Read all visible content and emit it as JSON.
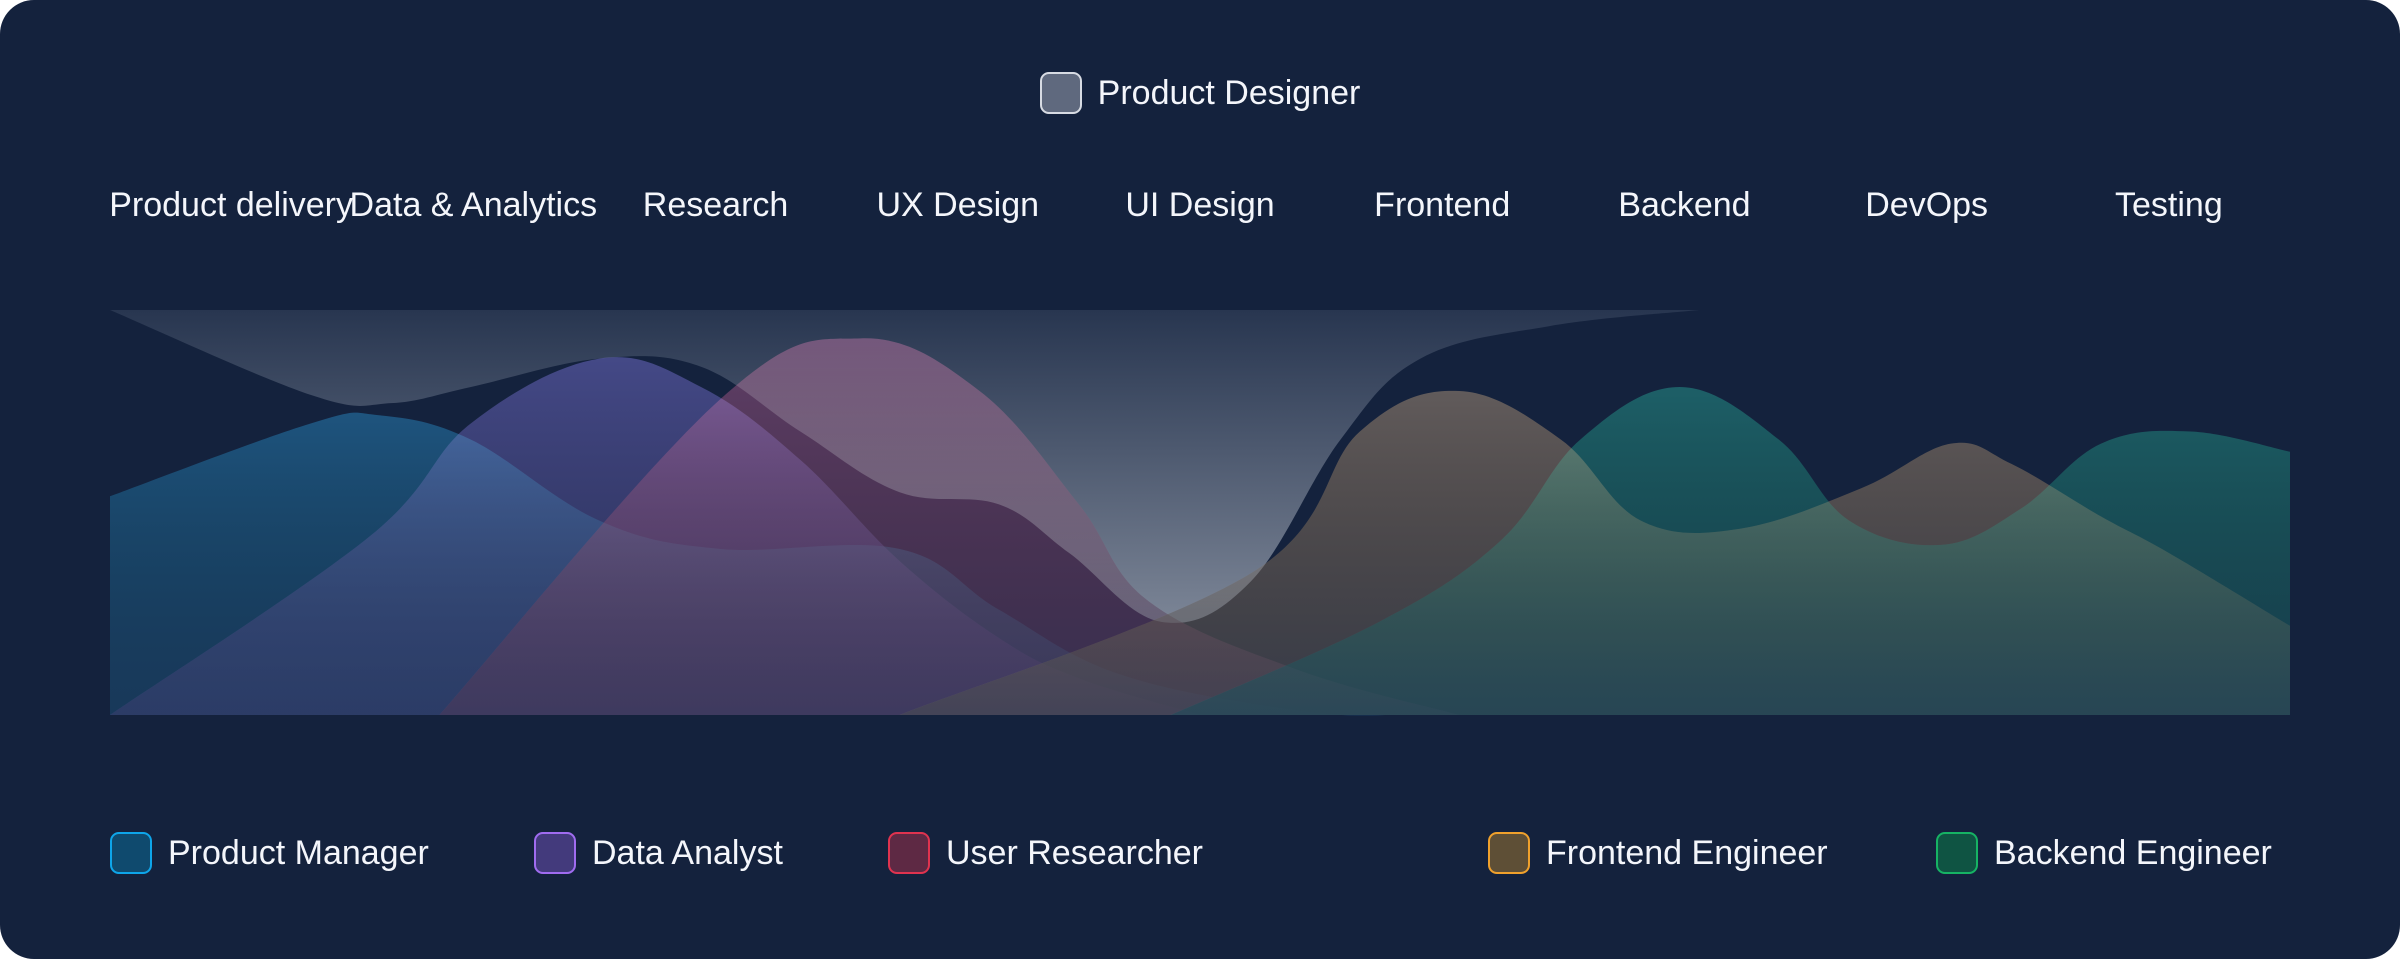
{
  "chart_data": {
    "type": "area",
    "title": "Product Designer",
    "categories": [
      "Product delivery",
      "Data & Analytics",
      "Research",
      "UX Design",
      "UI Design",
      "Frontend",
      "Backend",
      "DevOps",
      "Testing"
    ],
    "ylim": [
      0,
      100
    ],
    "xlim": [
      0,
      9
    ],
    "grid": false,
    "legend_position": "bottom",
    "series": [
      {
        "name": "Product Designer",
        "role": "highlight",
        "fill": "#5e6a80",
        "stroke": "#c9ced8",
        "hanging_from_top": true,
        "points": [
          [
            0.0,
            100
          ],
          [
            0.83,
            79
          ],
          [
            1.16,
            77
          ],
          [
            1.49,
            81
          ],
          [
            2.02,
            88
          ],
          [
            2.44,
            86
          ],
          [
            2.85,
            70
          ],
          [
            3.26,
            55
          ],
          [
            3.67,
            52
          ],
          [
            3.96,
            40
          ],
          [
            4.34,
            23
          ],
          [
            4.71,
            33
          ],
          [
            5.08,
            68
          ],
          [
            5.41,
            88
          ],
          [
            5.94,
            96
          ],
          [
            6.56,
            100
          ]
        ]
      },
      {
        "name": "Product Manager",
        "fill": "#0e4a6e",
        "stroke": "#0ea5e9",
        "points": [
          [
            0.0,
            54
          ],
          [
            0.83,
            72
          ],
          [
            1.11,
            74
          ],
          [
            1.49,
            68
          ],
          [
            2.02,
            48
          ],
          [
            2.52,
            41
          ],
          [
            3.26,
            41
          ],
          [
            3.67,
            26
          ],
          [
            4.17,
            10
          ],
          [
            4.91,
            1
          ],
          [
            5.33,
            0
          ]
        ]
      },
      {
        "name": "Data Analyst",
        "fill": "#433a7c",
        "stroke": "#8b5cf6",
        "points": [
          [
            0.0,
            0
          ],
          [
            1.07,
            44
          ],
          [
            1.49,
            72
          ],
          [
            2.02,
            88
          ],
          [
            2.44,
            81
          ],
          [
            2.85,
            63
          ],
          [
            3.26,
            38
          ],
          [
            3.67,
            19
          ],
          [
            4.0,
            9
          ],
          [
            4.5,
            0
          ]
        ]
      },
      {
        "name": "User Researcher",
        "fill": "#6b2d48",
        "stroke": "#e11d48",
        "points": [
          [
            1.36,
            0
          ],
          [
            2.52,
            78
          ],
          [
            3.1,
            93
          ],
          [
            3.59,
            80
          ],
          [
            4.0,
            52
          ],
          [
            4.29,
            28
          ],
          [
            4.91,
            11
          ],
          [
            5.57,
            0
          ]
        ]
      },
      {
        "name": "Frontend Engineer",
        "fill": "#6b5532",
        "stroke": "#f59e0b",
        "points": [
          [
            3.26,
            0
          ],
          [
            4.71,
            35
          ],
          [
            5.16,
            70
          ],
          [
            5.57,
            80
          ],
          [
            5.99,
            68
          ],
          [
            6.32,
            48
          ],
          [
            6.73,
            46
          ],
          [
            7.23,
            56
          ],
          [
            7.6,
            67
          ],
          [
            7.85,
            62
          ],
          [
            8.22,
            49
          ],
          [
            8.5,
            40
          ],
          [
            9.0,
            22
          ]
        ]
      },
      {
        "name": "Backend Engineer",
        "fill": "#0d5a46",
        "stroke": "#10b981",
        "points": [
          [
            4.38,
            0
          ],
          [
            5.24,
            23
          ],
          [
            5.74,
            43
          ],
          [
            6.07,
            68
          ],
          [
            6.48,
            81
          ],
          [
            6.89,
            68
          ],
          [
            7.18,
            48
          ],
          [
            7.56,
            42
          ],
          [
            7.89,
            51
          ],
          [
            8.22,
            67
          ],
          [
            8.59,
            70
          ],
          [
            9.0,
            65
          ]
        ]
      }
    ]
  },
  "header": {
    "title": "Product Designer",
    "title_swatch_fill": "#5f697e",
    "title_swatch_stroke": "#d7dbe3"
  },
  "legend": [
    {
      "label": "Product Manager",
      "fill": "#0f4a6e",
      "stroke": "#0ea5e9"
    },
    {
      "label": "Data Analyst",
      "fill": "#433a7c",
      "stroke": "#a06cf0"
    },
    {
      "label": "User Researcher",
      "fill": "#5e2944",
      "stroke": "#e0334f"
    },
    {
      "label": "Frontend Engineer",
      "fill": "#5e4f36",
      "stroke": "#f0a12c"
    },
    {
      "label": "Backend Engineer",
      "fill": "#0f5443",
      "stroke": "#16b364"
    }
  ],
  "colors": {
    "background": "#14223d",
    "text": "#f4f6fb"
  }
}
